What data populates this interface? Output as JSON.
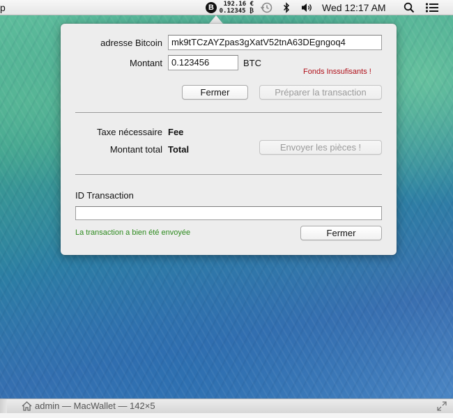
{
  "menubar": {
    "app_fragment": "p",
    "btc_price": "192.16 €",
    "btc_balance": "0.12345 ₿",
    "btc_glyph": "B",
    "clock": "Wed 12:17 AM",
    "icons": [
      "bitcoin-icon",
      "time-machine-icon",
      "bluetooth-icon",
      "volume-icon",
      "spotlight-icon",
      "notification-center-icon"
    ]
  },
  "form": {
    "address_label": "adresse Bitcoin",
    "address_value": "mk9tTCzAYZpas3gXatV52tnA63DEgngoq4",
    "amount_label": "Montant",
    "amount_value": "0.123456",
    "currency": "BTC",
    "warning": "Fonds Inssufisants !",
    "close_label": "Fermer",
    "prepare_label": "Préparer la transaction",
    "fee_label": "Taxe nécessaire",
    "fee_value": "Fee",
    "total_label": "Montant total",
    "total_value": "Total",
    "send_label": "Envoyer les pièces !",
    "txid_label": "ID Transaction",
    "txid_value": "",
    "success": "La transaction a bien été envoyée",
    "close2_label": "Fermer"
  },
  "colors": {
    "warning": "#b0101a",
    "success": "#2d8a1e"
  },
  "terminal": {
    "title": "admin — MacWallet — 142×5"
  }
}
